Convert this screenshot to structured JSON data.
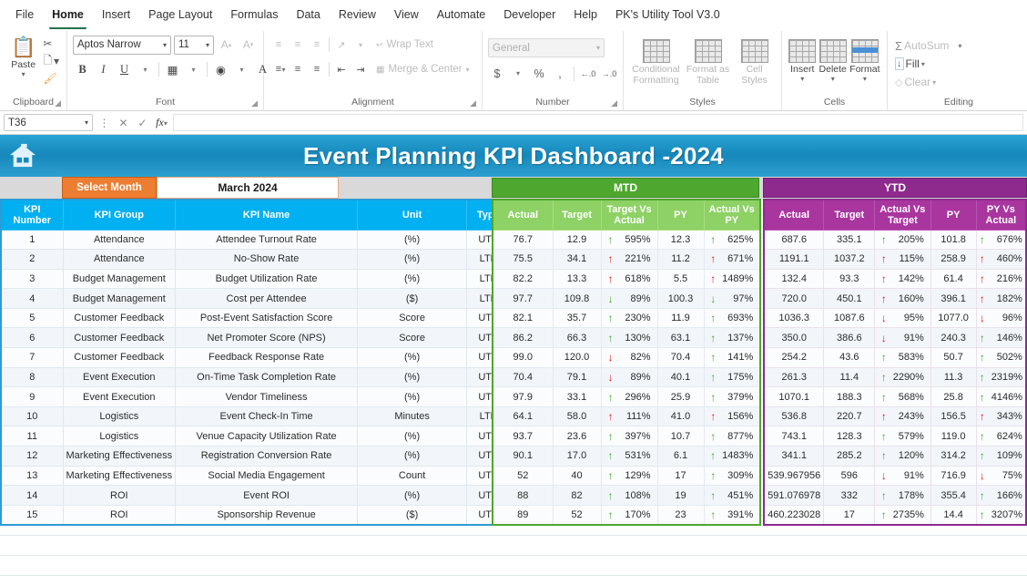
{
  "ribbon": {
    "tabs": [
      {
        "label": "File",
        "active": false
      },
      {
        "label": "Home",
        "active": true
      },
      {
        "label": "Insert",
        "active": false
      },
      {
        "label": "Page Layout",
        "active": false
      },
      {
        "label": "Formulas",
        "active": false
      },
      {
        "label": "Data",
        "active": false
      },
      {
        "label": "Review",
        "active": false
      },
      {
        "label": "View",
        "active": false
      },
      {
        "label": "Automate",
        "active": false
      },
      {
        "label": "Developer",
        "active": false
      },
      {
        "label": "Help",
        "active": false
      },
      {
        "label": "PK's Utility Tool V3.0",
        "active": false
      }
    ],
    "clipboard": {
      "group_label": "Clipboard",
      "paste_label": "Paste",
      "cut_label": "Cut",
      "copy_label": "Copy",
      "format_painter_label": "Format Painter"
    },
    "font": {
      "group_label": "Font",
      "font_name": "Aptos Narrow",
      "font_size": "11",
      "grow_label": "A",
      "shrink_label": "A",
      "bold_label": "B",
      "italic_label": "I",
      "underline_label": "U"
    },
    "alignment": {
      "group_label": "Alignment",
      "wrap_text_label": "Wrap Text",
      "merge_center_label": "Merge & Center"
    },
    "number": {
      "group_label": "Number",
      "format_value": "General",
      "currency_label": "$",
      "percent_label": "%",
      "comma_label": ",",
      "inc_dec_label": ".00",
      "dec_dec_label": ".00"
    },
    "styles": {
      "group_label": "Styles",
      "conditional_formatting_label": "Conditional Formatting",
      "format_as_table_label": "Format as Table",
      "cell_styles_label": "Cell Styles"
    },
    "cells": {
      "group_label": "Cells",
      "insert_label": "Insert",
      "delete_label": "Delete",
      "format_label": "Format"
    },
    "editing": {
      "group_label": "Editing",
      "autosum_label": "AutoSum",
      "fill_label": "Fill",
      "clear_label": "Clear"
    }
  },
  "formula_bar": {
    "name_box": "T36",
    "formula_value": "",
    "cancel_label": "✕",
    "enter_label": "✓",
    "fx_label": "fx"
  },
  "dashboard": {
    "title": "Event Planning KPI Dashboard -2024",
    "home_icon": "home-icon",
    "select_month_label": "Select Month",
    "selected_month": "March 2024",
    "mtd_band": "MTD",
    "ytd_band": "YTD"
  },
  "table": {
    "left_headers": [
      "KPI Number",
      "KPI Group",
      "KPI Name",
      "Unit",
      "Type"
    ],
    "mtd_headers": [
      "Actual",
      "Target",
      "Target Vs Actual",
      "PY",
      "Actual Vs PY"
    ],
    "ytd_headers": [
      "Actual",
      "Target",
      "Actual Vs Target",
      "PY",
      "PY Vs Actual"
    ],
    "rows": [
      {
        "num": "1",
        "group": "Attendance",
        "name": "Attendee Turnout Rate",
        "unit": "(%)",
        "type": "UTB",
        "mtd": {
          "actual": "76.7",
          "target": "12.9",
          "tva_dir": "up",
          "tva_color": "#3fa72e",
          "tva_pct": "595%",
          "py": "12.3",
          "avp_dir": "up",
          "avp_color": "#3fa72e",
          "avp_pct": "625%"
        },
        "ytd": {
          "actual": "687.6",
          "target": "335.1",
          "avt_dir": "up",
          "avt_color": "#3fa72e",
          "avt_pct": "205%",
          "py": "101.8",
          "pva_dir": "up",
          "pva_color": "#3fa72e",
          "pva_pct": "676%"
        }
      },
      {
        "num": "2",
        "group": "Attendance",
        "name": "No-Show Rate",
        "unit": "(%)",
        "type": "LTB",
        "mtd": {
          "actual": "75.5",
          "target": "34.1",
          "tva_dir": "up",
          "tva_color": "#e01a1a",
          "tva_pct": "221%",
          "py": "11.2",
          "avp_dir": "up",
          "avp_color": "#e01a1a",
          "avp_pct": "671%"
        },
        "ytd": {
          "actual": "1191.1",
          "target": "1037.2",
          "avt_dir": "up",
          "avt_color": "#e01a1a",
          "avt_pct": "115%",
          "py": "258.9",
          "pva_dir": "up",
          "pva_color": "#e01a1a",
          "pva_pct": "460%"
        }
      },
      {
        "num": "3",
        "group": "Budget Management",
        "name": "Budget Utilization Rate",
        "unit": "(%)",
        "type": "LTB",
        "mtd": {
          "actual": "82.2",
          "target": "13.3",
          "tva_dir": "up",
          "tva_color": "#e01a1a",
          "tva_pct": "618%",
          "py": "5.5",
          "avp_dir": "up",
          "avp_color": "#e01a1a",
          "avp_pct": "1489%"
        },
        "ytd": {
          "actual": "132.4",
          "target": "93.3",
          "avt_dir": "up",
          "avt_color": "#e01a1a",
          "avt_pct": "142%",
          "py": "61.4",
          "pva_dir": "up",
          "pva_color": "#e01a1a",
          "pva_pct": "216%"
        }
      },
      {
        "num": "4",
        "group": "Budget Management",
        "name": "Cost per Attendee",
        "unit": "($)",
        "type": "LTB",
        "mtd": {
          "actual": "97.7",
          "target": "109.8",
          "tva_dir": "down",
          "tva_color": "#3fa72e",
          "tva_pct": "89%",
          "py": "100.3",
          "avp_dir": "down",
          "avp_color": "#3fa72e",
          "avp_pct": "97%"
        },
        "ytd": {
          "actual": "720.0",
          "target": "450.1",
          "avt_dir": "up",
          "avt_color": "#e01a1a",
          "avt_pct": "160%",
          "py": "396.1",
          "pva_dir": "up",
          "pva_color": "#e01a1a",
          "pva_pct": "182%"
        }
      },
      {
        "num": "5",
        "group": "Customer Feedback",
        "name": "Post-Event Satisfaction Score",
        "unit": "Score",
        "type": "UTB",
        "mtd": {
          "actual": "82.1",
          "target": "35.7",
          "tva_dir": "up",
          "tva_color": "#3fa72e",
          "tva_pct": "230%",
          "py": "11.9",
          "avp_dir": "up",
          "avp_color": "#3fa72e",
          "avp_pct": "693%"
        },
        "ytd": {
          "actual": "1036.3",
          "target": "1087.6",
          "avt_dir": "down",
          "avt_color": "#e01a1a",
          "avt_pct": "95%",
          "py": "1077.0",
          "pva_dir": "down",
          "pva_color": "#e01a1a",
          "pva_pct": "96%"
        }
      },
      {
        "num": "6",
        "group": "Customer Feedback",
        "name": "Net Promoter Score (NPS)",
        "unit": "Score",
        "type": "UTB",
        "mtd": {
          "actual": "86.2",
          "target": "66.3",
          "tva_dir": "up",
          "tva_color": "#3fa72e",
          "tva_pct": "130%",
          "py": "63.1",
          "avp_dir": "up",
          "avp_color": "#3fa72e",
          "avp_pct": "137%"
        },
        "ytd": {
          "actual": "350.0",
          "target": "386.6",
          "avt_dir": "down",
          "avt_color": "#e01a1a",
          "avt_pct": "91%",
          "py": "240.3",
          "pva_dir": "up",
          "pva_color": "#3fa72e",
          "pva_pct": "146%"
        }
      },
      {
        "num": "7",
        "group": "Customer Feedback",
        "name": "Feedback Response Rate",
        "unit": "(%)",
        "type": "UTB",
        "mtd": {
          "actual": "99.0",
          "target": "120.0",
          "tva_dir": "down",
          "tva_color": "#e01a1a",
          "tva_pct": "82%",
          "py": "70.4",
          "avp_dir": "up",
          "avp_color": "#3fa72e",
          "avp_pct": "141%"
        },
        "ytd": {
          "actual": "254.2",
          "target": "43.6",
          "avt_dir": "up",
          "avt_color": "#3fa72e",
          "avt_pct": "583%",
          "py": "50.7",
          "pva_dir": "up",
          "pva_color": "#3fa72e",
          "pva_pct": "502%"
        }
      },
      {
        "num": "8",
        "group": "Event Execution",
        "name": "On-Time Task Completion Rate",
        "unit": "(%)",
        "type": "UTB",
        "mtd": {
          "actual": "70.4",
          "target": "79.1",
          "tva_dir": "down",
          "tva_color": "#e01a1a",
          "tva_pct": "89%",
          "py": "40.1",
          "avp_dir": "up",
          "avp_color": "#3fa72e",
          "avp_pct": "175%"
        },
        "ytd": {
          "actual": "261.3",
          "target": "11.4",
          "avt_dir": "up",
          "avt_color": "#3fa72e",
          "avt_pct": "2290%",
          "py": "11.3",
          "pva_dir": "up",
          "pva_color": "#3fa72e",
          "pva_pct": "2319%"
        }
      },
      {
        "num": "9",
        "group": "Event Execution",
        "name": "Vendor Timeliness",
        "unit": "(%)",
        "type": "UTB",
        "mtd": {
          "actual": "97.9",
          "target": "33.1",
          "tva_dir": "up",
          "tva_color": "#3fa72e",
          "tva_pct": "296%",
          "py": "25.9",
          "avp_dir": "up",
          "avp_color": "#3fa72e",
          "avp_pct": "379%"
        },
        "ytd": {
          "actual": "1070.1",
          "target": "188.3",
          "avt_dir": "up",
          "avt_color": "#3fa72e",
          "avt_pct": "568%",
          "py": "25.8",
          "pva_dir": "up",
          "pva_color": "#3fa72e",
          "pva_pct": "4146%"
        }
      },
      {
        "num": "10",
        "group": "Logistics",
        "name": "Event Check-In Time",
        "unit": "Minutes",
        "type": "LTB",
        "mtd": {
          "actual": "64.1",
          "target": "58.0",
          "tva_dir": "up",
          "tva_color": "#e01a1a",
          "tva_pct": "111%",
          "py": "41.0",
          "avp_dir": "up",
          "avp_color": "#e01a1a",
          "avp_pct": "156%"
        },
        "ytd": {
          "actual": "536.8",
          "target": "220.7",
          "avt_dir": "up",
          "avt_color": "#e01a1a",
          "avt_pct": "243%",
          "py": "156.5",
          "pva_dir": "up",
          "pva_color": "#e01a1a",
          "pva_pct": "343%"
        }
      },
      {
        "num": "11",
        "group": "Logistics",
        "name": "Venue Capacity Utilization Rate",
        "unit": "(%)",
        "type": "UTB",
        "mtd": {
          "actual": "93.7",
          "target": "23.6",
          "tva_dir": "up",
          "tva_color": "#3fa72e",
          "tva_pct": "397%",
          "py": "10.7",
          "avp_dir": "up",
          "avp_color": "#3fa72e",
          "avp_pct": "877%"
        },
        "ytd": {
          "actual": "743.1",
          "target": "128.3",
          "avt_dir": "up",
          "avt_color": "#3fa72e",
          "avt_pct": "579%",
          "py": "119.0",
          "pva_dir": "up",
          "pva_color": "#3fa72e",
          "pva_pct": "624%"
        }
      },
      {
        "num": "12",
        "group": "Marketing Effectiveness",
        "name": "Registration Conversion Rate",
        "unit": "(%)",
        "type": "UTB",
        "mtd": {
          "actual": "90.1",
          "target": "17.0",
          "tva_dir": "up",
          "tva_color": "#3fa72e",
          "tva_pct": "531%",
          "py": "6.1",
          "avp_dir": "up",
          "avp_color": "#3fa72e",
          "avp_pct": "1483%"
        },
        "ytd": {
          "actual": "341.1",
          "target": "285.2",
          "avt_dir": "up",
          "avt_color": "#3fa72e",
          "avt_pct": "120%",
          "py": "314.2",
          "pva_dir": "up",
          "pva_color": "#3fa72e",
          "pva_pct": "109%"
        }
      },
      {
        "num": "13",
        "group": "Marketing Effectiveness",
        "name": "Social Media Engagement",
        "unit": "Count",
        "type": "UTB",
        "mtd": {
          "actual": "52",
          "target": "40",
          "tva_dir": "up",
          "tva_color": "#3fa72e",
          "tva_pct": "129%",
          "py": "17",
          "avp_dir": "up",
          "avp_color": "#3fa72e",
          "avp_pct": "309%"
        },
        "ytd": {
          "actual": "539.967956",
          "target": "596",
          "avt_dir": "down",
          "avt_color": "#e01a1a",
          "avt_pct": "91%",
          "py": "716.9",
          "pva_dir": "down",
          "pva_color": "#e01a1a",
          "pva_pct": "75%"
        }
      },
      {
        "num": "14",
        "group": "ROI",
        "name": "Event ROI",
        "unit": "(%)",
        "type": "UTB",
        "mtd": {
          "actual": "88",
          "target": "82",
          "tva_dir": "up",
          "tva_color": "#3fa72e",
          "tva_pct": "108%",
          "py": "19",
          "avp_dir": "up",
          "avp_color": "#3fa72e",
          "avp_pct": "451%"
        },
        "ytd": {
          "actual": "591.076978",
          "target": "332",
          "avt_dir": "up",
          "avt_color": "#3fa72e",
          "avt_pct": "178%",
          "py": "355.4",
          "pva_dir": "up",
          "pva_color": "#3fa72e",
          "pva_pct": "166%"
        }
      },
      {
        "num": "15",
        "group": "ROI",
        "name": "Sponsorship Revenue",
        "unit": "($)",
        "type": "UTB",
        "mtd": {
          "actual": "89",
          "target": "52",
          "tva_dir": "up",
          "tva_color": "#3fa72e",
          "tva_pct": "170%",
          "py": "23",
          "avp_dir": "up",
          "avp_color": "#3fa72e",
          "avp_pct": "391%"
        },
        "ytd": {
          "actual": "460.223028",
          "target": "17",
          "avt_dir": "up",
          "avt_color": "#3fa72e",
          "avt_pct": "2735%",
          "py": "14.4",
          "pva_dir": "up",
          "pva_color": "#3fa72e",
          "pva_pct": "3207%"
        }
      }
    ]
  }
}
